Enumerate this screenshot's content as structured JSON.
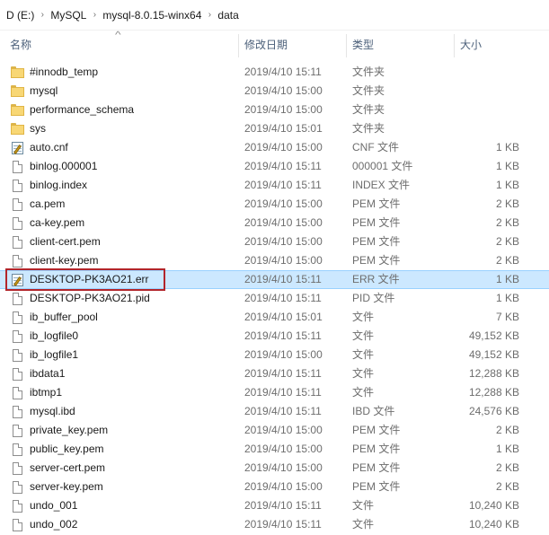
{
  "breadcrumb": {
    "items": [
      "D (E:)",
      "MySQL",
      "mysql-8.0.15-winx64",
      "data"
    ],
    "separator": "›"
  },
  "columns": {
    "name": "名称",
    "date": "修改日期",
    "type": "类型",
    "size": "大小",
    "sort_indicator": "^"
  },
  "files": [
    {
      "name": "#innodb_temp",
      "date": "2019/4/10 15:11",
      "type": "文件夹",
      "size": "",
      "icon": "folder-icon"
    },
    {
      "name": "mysql",
      "date": "2019/4/10 15:00",
      "type": "文件夹",
      "size": "",
      "icon": "folder-icon"
    },
    {
      "name": "performance_schema",
      "date": "2019/4/10 15:00",
      "type": "文件夹",
      "size": "",
      "icon": "folder-icon"
    },
    {
      "name": "sys",
      "date": "2019/4/10 15:01",
      "type": "文件夹",
      "size": "",
      "icon": "folder-icon"
    },
    {
      "name": "auto.cnf",
      "date": "2019/4/10 15:00",
      "type": "CNF 文件",
      "size": "1 KB",
      "icon": "notepad-icon"
    },
    {
      "name": "binlog.000001",
      "date": "2019/4/10 15:11",
      "type": "000001 文件",
      "size": "1 KB",
      "icon": "file-icon"
    },
    {
      "name": "binlog.index",
      "date": "2019/4/10 15:11",
      "type": "INDEX 文件",
      "size": "1 KB",
      "icon": "file-icon"
    },
    {
      "name": "ca.pem",
      "date": "2019/4/10 15:00",
      "type": "PEM 文件",
      "size": "2 KB",
      "icon": "file-icon"
    },
    {
      "name": "ca-key.pem",
      "date": "2019/4/10 15:00",
      "type": "PEM 文件",
      "size": "2 KB",
      "icon": "file-icon"
    },
    {
      "name": "client-cert.pem",
      "date": "2019/4/10 15:00",
      "type": "PEM 文件",
      "size": "2 KB",
      "icon": "file-icon"
    },
    {
      "name": "client-key.pem",
      "date": "2019/4/10 15:00",
      "type": "PEM 文件",
      "size": "2 KB",
      "icon": "file-icon"
    },
    {
      "name": "DESKTOP-PK3AO21.err",
      "date": "2019/4/10 15:11",
      "type": "ERR 文件",
      "size": "1 KB",
      "icon": "notepad-icon",
      "selected": true
    },
    {
      "name": "DESKTOP-PK3AO21.pid",
      "date": "2019/4/10 15:11",
      "type": "PID 文件",
      "size": "1 KB",
      "icon": "file-icon"
    },
    {
      "name": "ib_buffer_pool",
      "date": "2019/4/10 15:01",
      "type": "文件",
      "size": "7 KB",
      "icon": "file-icon"
    },
    {
      "name": "ib_logfile0",
      "date": "2019/4/10 15:11",
      "type": "文件",
      "size": "49,152 KB",
      "icon": "file-icon"
    },
    {
      "name": "ib_logfile1",
      "date": "2019/4/10 15:00",
      "type": "文件",
      "size": "49,152 KB",
      "icon": "file-icon"
    },
    {
      "name": "ibdata1",
      "date": "2019/4/10 15:11",
      "type": "文件",
      "size": "12,288 KB",
      "icon": "file-icon"
    },
    {
      "name": "ibtmp1",
      "date": "2019/4/10 15:11",
      "type": "文件",
      "size": "12,288 KB",
      "icon": "file-icon"
    },
    {
      "name": "mysql.ibd",
      "date": "2019/4/10 15:11",
      "type": "IBD 文件",
      "size": "24,576 KB",
      "icon": "file-icon"
    },
    {
      "name": "private_key.pem",
      "date": "2019/4/10 15:00",
      "type": "PEM 文件",
      "size": "2 KB",
      "icon": "file-icon"
    },
    {
      "name": "public_key.pem",
      "date": "2019/4/10 15:00",
      "type": "PEM 文件",
      "size": "1 KB",
      "icon": "file-icon"
    },
    {
      "name": "server-cert.pem",
      "date": "2019/4/10 15:00",
      "type": "PEM 文件",
      "size": "2 KB",
      "icon": "file-icon"
    },
    {
      "name": "server-key.pem",
      "date": "2019/4/10 15:00",
      "type": "PEM 文件",
      "size": "2 KB",
      "icon": "file-icon"
    },
    {
      "name": "undo_001",
      "date": "2019/4/10 15:11",
      "type": "文件",
      "size": "10,240 KB",
      "icon": "file-icon"
    },
    {
      "name": "undo_002",
      "date": "2019/4/10 15:11",
      "type": "文件",
      "size": "10,240 KB",
      "icon": "file-icon"
    }
  ],
  "colors": {
    "selection_bg": "#cce8ff",
    "selection_border": "#99d1ff",
    "highlight_box": "#b2252b",
    "header_text": "#4c607a",
    "folder_yellow": "#f8d775"
  }
}
